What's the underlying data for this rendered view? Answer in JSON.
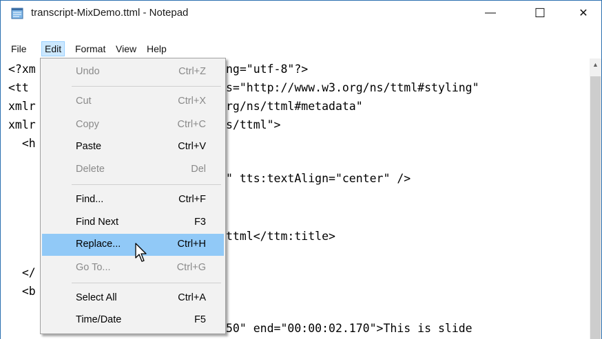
{
  "window": {
    "title": "transcript-MixDemo.ttml - Notepad",
    "controls": {
      "minimize": "—",
      "maximize": "☐",
      "close": "✕"
    }
  },
  "menubar": [
    "File",
    "Edit",
    "Format",
    "View",
    "Help"
  ],
  "editor": {
    "lines": [
      "<?xml version=\"1.0\" encoding=\"utf-8\"?>",
      "<tt xmlns=\"http://www.w3.org/ns/ttml\" xmlns:tts=\"http://www.w3.org/ns/ttml#styling\"",
      "xmlns:ttm=\"http://www.w3.org/ns/ttml#metadata\"",
      "xmlns=\"http://www.w3.org/ns/ttml\">",
      "  <head>",
      "",
      "      <style xml:id=\"s1\" tts:textAlign=\"center\" />",
      "",
      "",
      "      <ttm:title>transcript.ttml</ttm:title>",
      "",
      "",
      "  </head>",
      "  <body>",
      "",
      "    <p begin=\"00:00:00.050\" end=\"00:00:02.170\">This is slide"
    ],
    "visible_fragments": [
      "<?xm",
      "ng=\"utf-8\"?>",
      "<tt ",
      "s=\"http://www.w3.org/ns/ttml#styling\"",
      "xmlr",
      "rg/ns/ttml#metadata\"",
      "xmlr",
      "s/ttml\">",
      "  <h",
      "\" tts:textAlign=\"center\" />",
      "ttml</ttm:title>",
      "  </",
      "  <b",
      "50\" end=\"00:00:02.170\">This is slide"
    ]
  },
  "edit_menu": {
    "items": [
      {
        "label": "Undo",
        "shortcut": "Ctrl+Z",
        "state": "disabled"
      },
      {
        "label": "Cut",
        "shortcut": "Ctrl+X",
        "state": "disabled"
      },
      {
        "label": "Copy",
        "shortcut": "Ctrl+C",
        "state": "disabled"
      },
      {
        "label": "Paste",
        "shortcut": "Ctrl+V",
        "state": "enabled"
      },
      {
        "label": "Delete",
        "shortcut": "Del",
        "state": "disabled"
      },
      {
        "label": "Find...",
        "shortcut": "Ctrl+F",
        "state": "enabled"
      },
      {
        "label": "Find Next",
        "shortcut": "F3",
        "state": "enabled"
      },
      {
        "label": "Replace...",
        "shortcut": "Ctrl+H",
        "state": "hover"
      },
      {
        "label": "Go To...",
        "shortcut": "Ctrl+G",
        "state": "disabled"
      },
      {
        "label": "Select All",
        "shortcut": "Ctrl+A",
        "state": "enabled"
      },
      {
        "label": "Time/Date",
        "shortcut": "F5",
        "state": "enabled"
      }
    ]
  },
  "colors": {
    "menu_hover": "#91c9f7",
    "menubar_active": "#cce8ff",
    "window_border": "#2a6fb0"
  }
}
